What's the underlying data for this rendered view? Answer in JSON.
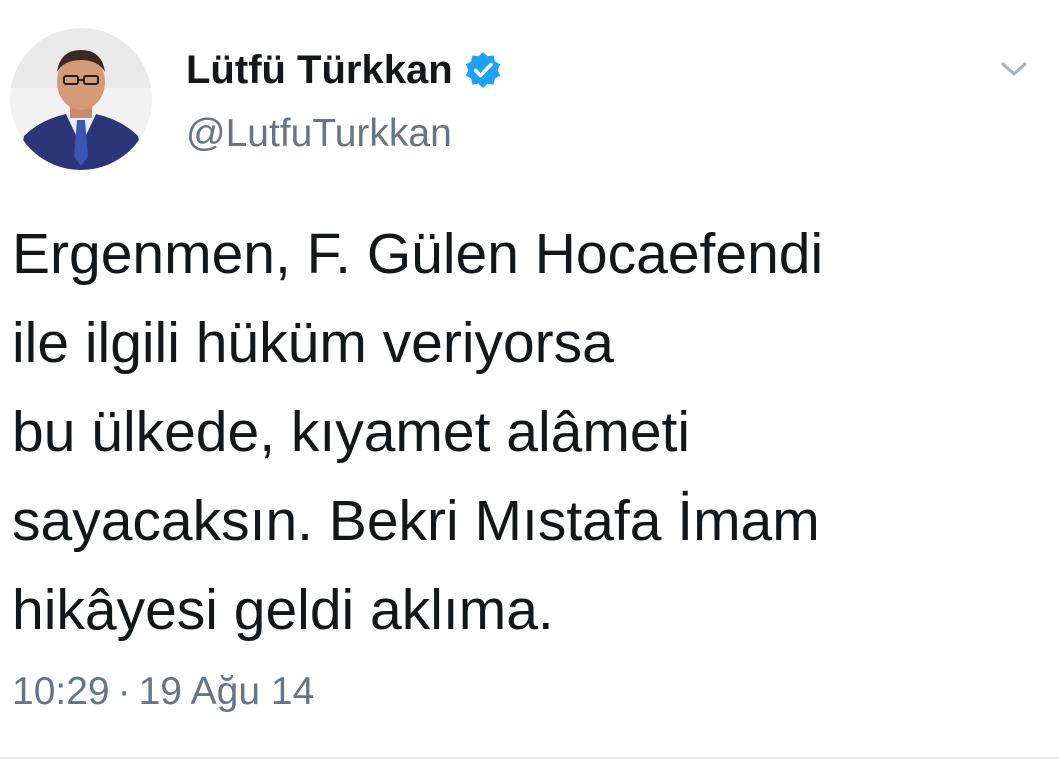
{
  "user": {
    "display_name": "Lütfü Türkkan",
    "handle": "@LutfuTurkkan",
    "verified": true,
    "avatar_icon": "profile-photo"
  },
  "tweet": {
    "lines": [
      "Ergenmen, F. Gülen Hocaefendi",
      "ile ilgili hüküm veriyorsa",
      "bu ülkede, kıyamet alâmeti",
      "sayacaksın. Bekri Mıstafa İmam",
      "hikâyesi geldi aklıma."
    ],
    "time": "10:29",
    "separator": "·",
    "date": "19 Ağu 14"
  },
  "icons": {
    "verified": "verified-badge-icon",
    "menu": "chevron-down-icon"
  },
  "colors": {
    "text": "#14171a",
    "secondary": "#657786",
    "verified": "#1da1f2",
    "divider": "#e6ecf0"
  }
}
